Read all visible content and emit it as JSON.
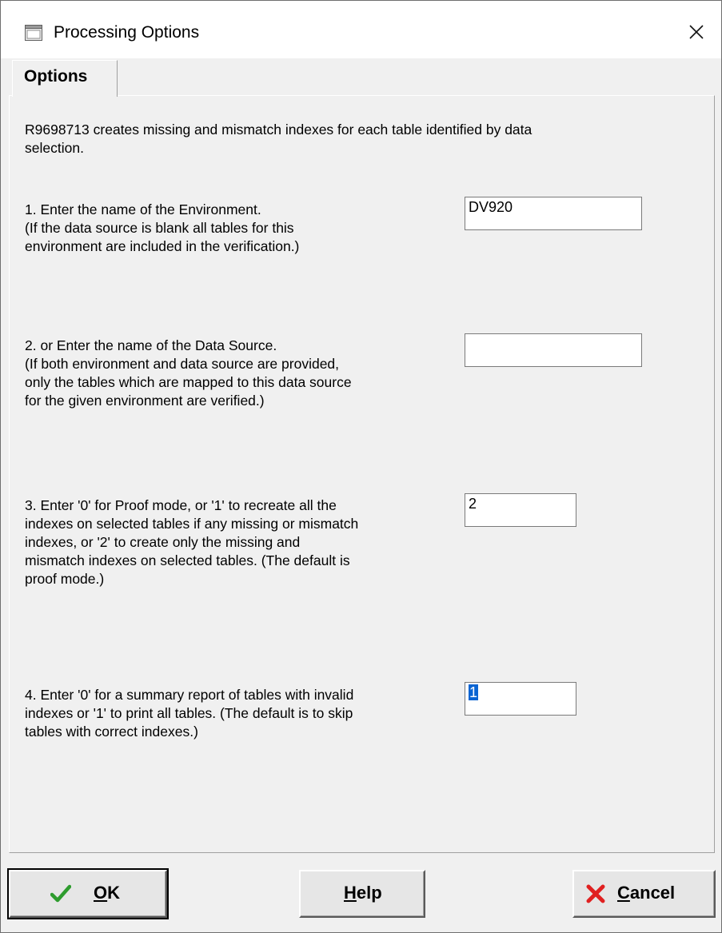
{
  "window": {
    "title": "Processing Options"
  },
  "tabs": [
    {
      "label": "Options",
      "active": true
    }
  ],
  "description": [
    "R9698713 creates missing and mismatch indexes for each table identified by data",
    "selection."
  ],
  "options": [
    {
      "lines": [
        "1. Enter the name of the Environment.",
        "(If the data source is blank all tables for this",
        "environment are included in the verification.)"
      ],
      "value": "DV920"
    },
    {
      "lines": [
        "2. or Enter the name of the Data Source.",
        "(If both environment and data source are provided,",
        "only the tables which are mapped to this data source",
        "for the given environment are verified.)"
      ],
      "value": ""
    },
    {
      "lines": [
        "3. Enter '0' for Proof mode, or '1' to recreate all the",
        "indexes on selected tables if any missing or mismatch",
        "indexes, or '2' to create only the missing and",
        "mismatch indexes on selected tables. (The default is",
        "proof mode.)"
      ],
      "value": "2"
    },
    {
      "lines": [
        "4. Enter '0' for a summary report of tables with invalid",
        "indexes or '1' to print all tables. (The default is to skip",
        "tables with correct indexes.)"
      ],
      "value": "1"
    }
  ],
  "buttons": {
    "ok": {
      "label_mnemonic": "O",
      "label_rest": "K",
      "icon": "checkmark-icon"
    },
    "help": {
      "label_mnemonic": "H",
      "label_rest": "elp"
    },
    "cancel": {
      "label_mnemonic": "C",
      "label_rest": "ancel",
      "icon": "red-x-icon"
    }
  },
  "colors": {
    "selection": "#0a64d2",
    "ok_icon": "#2e9c2e",
    "cancel_icon": "#e02020"
  }
}
